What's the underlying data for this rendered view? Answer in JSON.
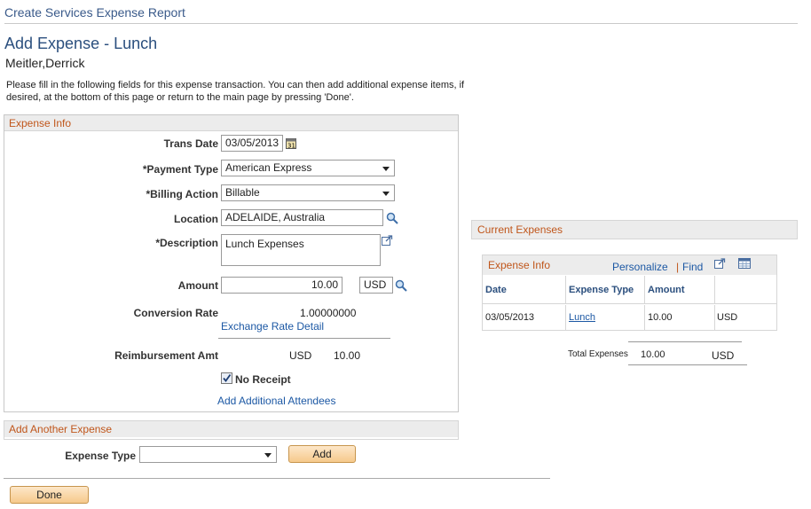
{
  "page": {
    "header": "Create Services Expense Report",
    "title": "Add Expense - Lunch",
    "employee_name": "Meitler,Derrick",
    "instructions": "Please fill in the following fields for this expense transaction. You can then add additional expense items, if desired, at the bottom of this page or return to the main page by pressing 'Done'."
  },
  "expense_info": {
    "section_title": "Expense Info",
    "trans_date_label": "Trans Date",
    "trans_date_value": "03/05/2013",
    "payment_type_label": "*Payment Type",
    "payment_type_value": "American Express",
    "billing_action_label": "*Billing Action",
    "billing_action_value": "Billable",
    "location_label": "Location",
    "location_value": "ADELAIDE, Australia",
    "description_label": "*Description",
    "description_value": "Lunch Expenses",
    "amount_label": "Amount",
    "amount_value": "10.00",
    "currency_value": "USD",
    "conversion_rate_label": "Conversion Rate",
    "conversion_rate_value": "1.00000000",
    "exchange_rate_link": "Exchange Rate Detail",
    "reimbursement_label": "Reimbursement Amt",
    "reimbursement_currency": "USD",
    "reimbursement_value": "10.00",
    "no_receipt_label": "No Receipt",
    "no_receipt_checked": true,
    "add_attendees_link": "Add Additional Attendees"
  },
  "add_another": {
    "section_title": "Add Another Expense",
    "expense_type_label": "Expense Type",
    "expense_type_value": "",
    "add_button": "Add"
  },
  "done_button": "Done",
  "current_expenses": {
    "section_title": "Current Expenses",
    "grid_title": "Expense Info",
    "personalize_link": "Personalize",
    "separator": "|",
    "find_link": "Find",
    "columns": [
      "Date",
      "Expense Type",
      "Amount"
    ],
    "rows": [
      {
        "date": "03/05/2013",
        "expense_type": "Lunch",
        "amount": "10.00",
        "currency": "USD"
      }
    ],
    "total_label": "Total Expenses",
    "total_value": "10.00",
    "total_currency": "USD"
  }
}
